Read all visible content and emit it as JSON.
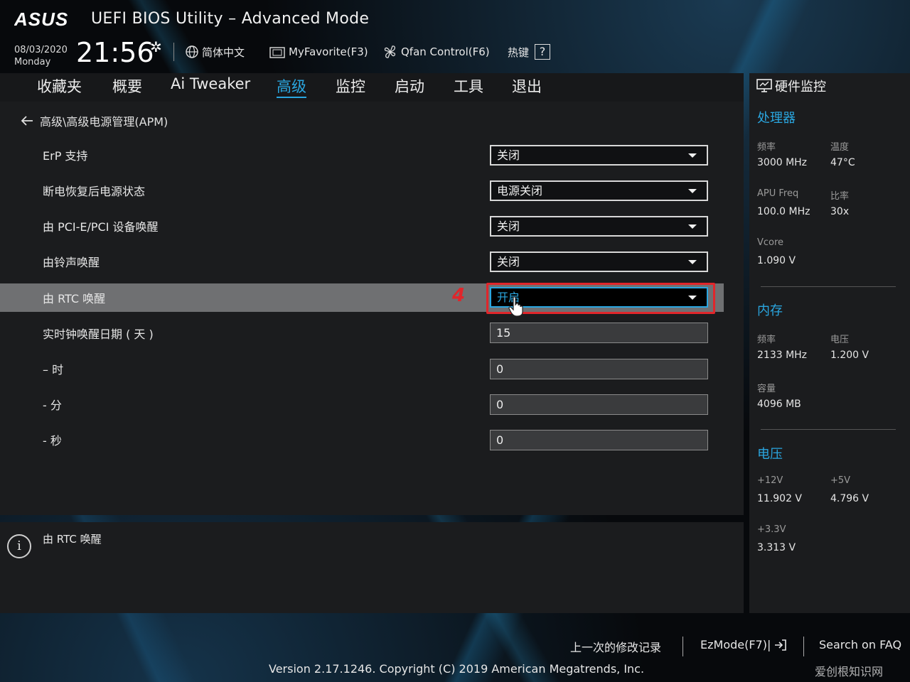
{
  "header": {
    "brand": "ASUS",
    "title": "UEFI BIOS Utility – Advanced Mode",
    "date": "08/03/2020",
    "weekday": "Monday",
    "time": "21:56",
    "toolbar": {
      "language": "简体中文",
      "favorite": "MyFavorite(F3)",
      "qfan": "Qfan Control(F6)",
      "hotkey": "热键",
      "hotkey_symbol": "?"
    }
  },
  "tabs": [
    {
      "label": "收藏夹"
    },
    {
      "label": "概要"
    },
    {
      "label": "Ai Tweaker"
    },
    {
      "label": "高级"
    },
    {
      "label": "监控"
    },
    {
      "label": "启动"
    },
    {
      "label": "工具"
    },
    {
      "label": "退出"
    }
  ],
  "active_tab": "高级",
  "breadcrumb": "高级\\高级电源管理(APM)",
  "settings": [
    {
      "label": "ErP 支持",
      "value": "关闭",
      "type": "select"
    },
    {
      "label": "断电恢复后电源状态",
      "value": "电源关闭",
      "type": "select"
    },
    {
      "label": "由 PCI-E/PCI 设备唤醒",
      "value": "关闭",
      "type": "select"
    },
    {
      "label": "由铃声唤醒",
      "value": "关闭",
      "type": "select"
    },
    {
      "label": "由 RTC 唤醒",
      "value": "开启",
      "type": "select"
    },
    {
      "label": "实时钟唤醒日期 ( 天 )",
      "value": "15",
      "type": "input"
    },
    {
      "label": "– 时",
      "value": "0",
      "type": "input"
    },
    {
      "label": "- 分",
      "value": "0",
      "type": "input"
    },
    {
      "label": "- 秒",
      "value": "0",
      "type": "input"
    }
  ],
  "annotation": {
    "step": "4"
  },
  "help": {
    "text": "由 RTC 唤醒"
  },
  "hw_monitor": {
    "title": "硬件监控",
    "cpu": {
      "title": "处理器",
      "freq_label": "频率",
      "freq": "3000 MHz",
      "temp_label": "温度",
      "temp": "47°C",
      "apu_label": "APU Freq",
      "apu": "100.0 MHz",
      "ratio_label": "比率",
      "ratio": "30x",
      "vcore_label": "Vcore",
      "vcore": "1.090 V"
    },
    "memory": {
      "title": "内存",
      "freq_label": "频率",
      "freq": "2133 MHz",
      "volt_label": "电压",
      "volt": "1.200 V",
      "cap_label": "容量",
      "cap": "4096 MB"
    },
    "voltage": {
      "title": "电压",
      "v12_label": "+12V",
      "v12": "11.902 V",
      "v5_label": "+5V",
      "v5": "4.796 V",
      "v33_label": "+3.3V",
      "v33": "3.313 V"
    }
  },
  "footer": {
    "last_changes": "上一次的修改记录",
    "ezmode": "EzMode(F7)|",
    "search": "Search on FAQ",
    "copyright": "Version 2.17.1246. Copyright (C) 2019 American Megatrends, Inc.",
    "watermark": "爱创根知识网"
  },
  "colors": {
    "accent": "#2aa6e0",
    "annotation": "#e0262b",
    "panel": "#1b1c1e"
  }
}
